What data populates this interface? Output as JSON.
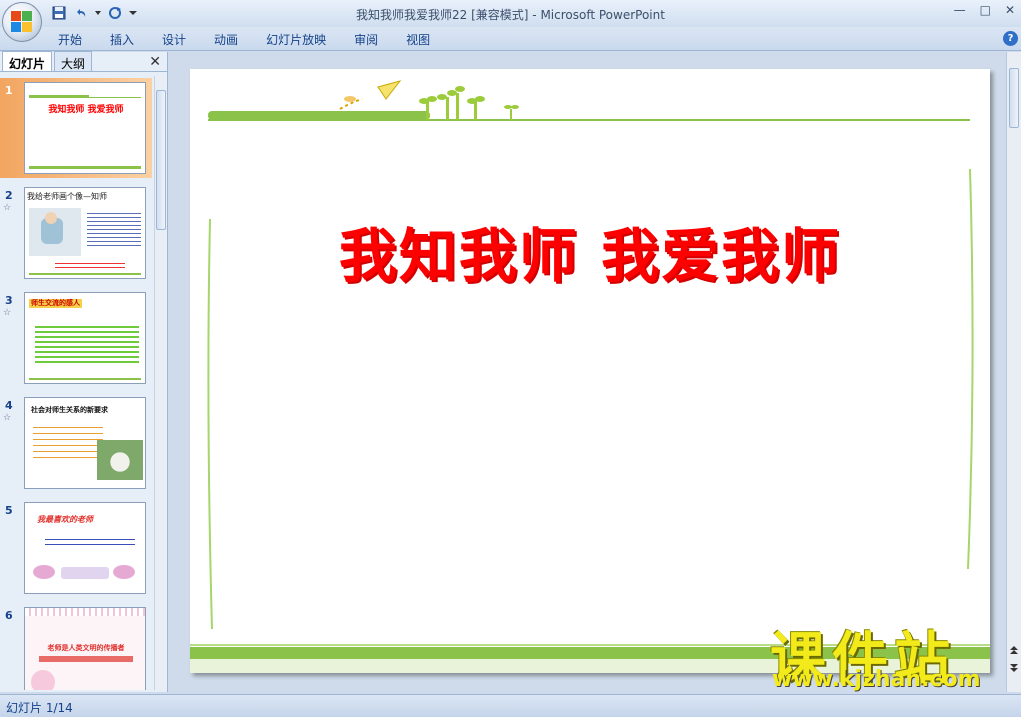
{
  "window": {
    "title": "我知我师我爱我师22 [兼容模式] - Microsoft PowerPoint",
    "controls": [
      "—",
      "□",
      "✕"
    ]
  },
  "ribbon": {
    "tabs": [
      "开始",
      "插入",
      "设计",
      "动画",
      "幻灯片放映",
      "审阅",
      "视图"
    ],
    "help": "?"
  },
  "left_panel": {
    "tabs": [
      "幻灯片",
      "大纲"
    ],
    "close": "✕",
    "thumbnails": [
      {
        "num": "1",
        "text": "我知我师  我爱我师"
      },
      {
        "num": "2",
        "text": "我给老师画个像—知师"
      },
      {
        "num": "3",
        "text": "师生交流的感人"
      },
      {
        "num": "4",
        "text": "社会对师生关系的新要求"
      },
      {
        "num": "5",
        "text": "我最喜欢的老师"
      },
      {
        "num": "6",
        "text": "老师是人类文明的传播者"
      }
    ]
  },
  "slide": {
    "title": "我知我师   我爱我师"
  },
  "status": {
    "text": "幻灯片 1/14"
  },
  "watermark": {
    "cn": "课件站",
    "url": "www.kjzhan.com"
  },
  "colors": {
    "title_red": "#ff0000",
    "green_line": "#8bc34a",
    "selected_thumb": "#f2a560"
  }
}
